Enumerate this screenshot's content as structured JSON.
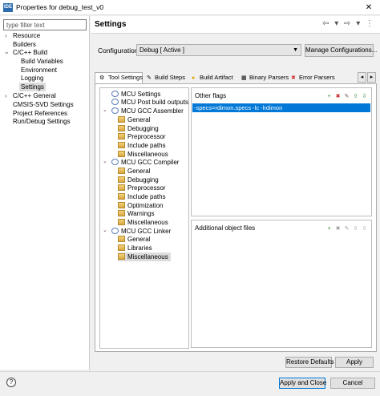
{
  "window": {
    "title": "Properties for debug_test_v0",
    "app_icon_text": "IDE",
    "close_symbol": "✕"
  },
  "left": {
    "filter_placeholder": "type filter text",
    "items": [
      {
        "label": "Resource",
        "twisty": "›"
      },
      {
        "label": "Builders",
        "twisty": ""
      },
      {
        "label": "C/C++ Build",
        "twisty": "⌄"
      },
      {
        "label": "Build Variables",
        "twisty": ""
      },
      {
        "label": "Environment",
        "twisty": ""
      },
      {
        "label": "Logging",
        "twisty": ""
      },
      {
        "label": "Settings",
        "twisty": ""
      },
      {
        "label": "C/C++ General",
        "twisty": "›"
      },
      {
        "label": "CMSIS-SVD Settings",
        "twisty": ""
      },
      {
        "label": "Project References",
        "twisty": ""
      },
      {
        "label": "Run/Debug Settings",
        "twisty": ""
      }
    ]
  },
  "header": {
    "title": "Settings",
    "nav_arrows": "⇦ ▾ ⇨ ▾ ⋮"
  },
  "configuration": {
    "label": "Configuration:",
    "value": "Debug  [ Active ]",
    "manage_label": "Manage Configurations..."
  },
  "tabs": [
    {
      "label": "Tool Settings",
      "icon": "⚙"
    },
    {
      "label": "Build Steps",
      "icon": "✎"
    },
    {
      "label": "Build Artifact",
      "icon": "●"
    },
    {
      "label": "Binary Parsers",
      "icon": "▦"
    },
    {
      "label": "Error Parsers",
      "icon": "✖"
    }
  ],
  "tab_scroll": {
    "left": "◂",
    "right": "▸"
  },
  "tree": [
    {
      "label": "MCU Settings"
    },
    {
      "label": "MCU Post build outputs"
    },
    {
      "label": "MCU GCC Assembler",
      "twisty": "⌄"
    },
    {
      "label": "General"
    },
    {
      "label": "Debugging"
    },
    {
      "label": "Preprocessor"
    },
    {
      "label": "Include paths"
    },
    {
      "label": "Miscellaneous"
    },
    {
      "label": "MCU GCC Compiler",
      "twisty": "⌄"
    },
    {
      "label": "General"
    },
    {
      "label": "Debugging"
    },
    {
      "label": "Preprocessor"
    },
    {
      "label": "Include paths"
    },
    {
      "label": "Optimization"
    },
    {
      "label": "Warnings"
    },
    {
      "label": "Miscellaneous"
    },
    {
      "label": "MCU GCC Linker",
      "twisty": "⌄"
    },
    {
      "label": "General"
    },
    {
      "label": "Libraries"
    },
    {
      "label": "Miscellaneous"
    }
  ],
  "other_flags": {
    "title": "Other flags",
    "value": "-specs=rdimon.specs -lc -lrdimon"
  },
  "additional_objects": {
    "title": "Additional object files"
  },
  "panel_tools": [
    "add-icon",
    "delete-icon",
    "edit-icon",
    "move-up-icon",
    "move-down-icon"
  ],
  "panel_tool_glyphs": [
    "+",
    "✖",
    "✎",
    "⇧",
    "⇩"
  ],
  "colors": {
    "selection": "#0078d7"
  },
  "buttons": {
    "restore": "Restore Defaults",
    "apply": "Apply",
    "apply_close": "Apply and Close",
    "cancel": "Cancel"
  },
  "help": {
    "symbol": "?"
  }
}
